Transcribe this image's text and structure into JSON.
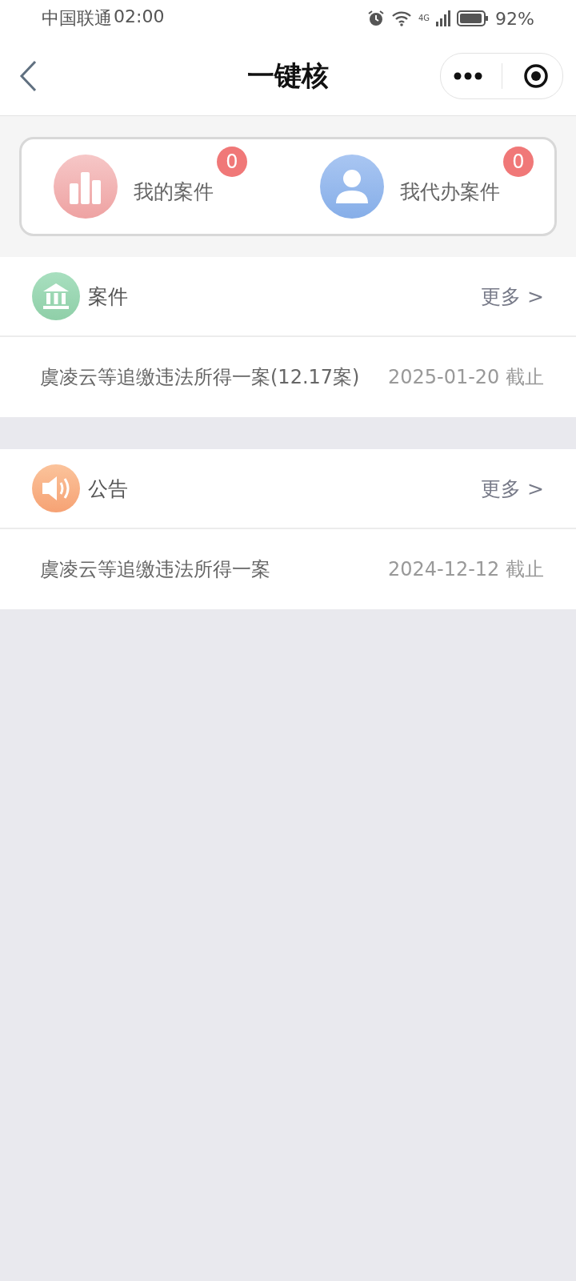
{
  "status_bar": {
    "carrier": "中国联通",
    "time": "02:00",
    "network": "4G",
    "battery": "92%"
  },
  "nav": {
    "title": "一键核"
  },
  "shortcuts": [
    {
      "kind": "chart",
      "label": "我的案件",
      "badge": "0"
    },
    {
      "kind": "person",
      "label": "我代办案件",
      "badge": "0"
    }
  ],
  "sections": [
    {
      "kind": "bank",
      "title": "案件",
      "more": "更多 >",
      "items": [
        {
          "title": "虞凌云等追缴违法所得一案(12.17案)",
          "deadline": "2025-01-20 截止"
        }
      ]
    },
    {
      "kind": "speaker",
      "title": "公告",
      "more": "更多 >",
      "items": [
        {
          "title": "虞凌云等追缴违法所得一案",
          "deadline": "2024-12-12 截止"
        }
      ]
    }
  ]
}
